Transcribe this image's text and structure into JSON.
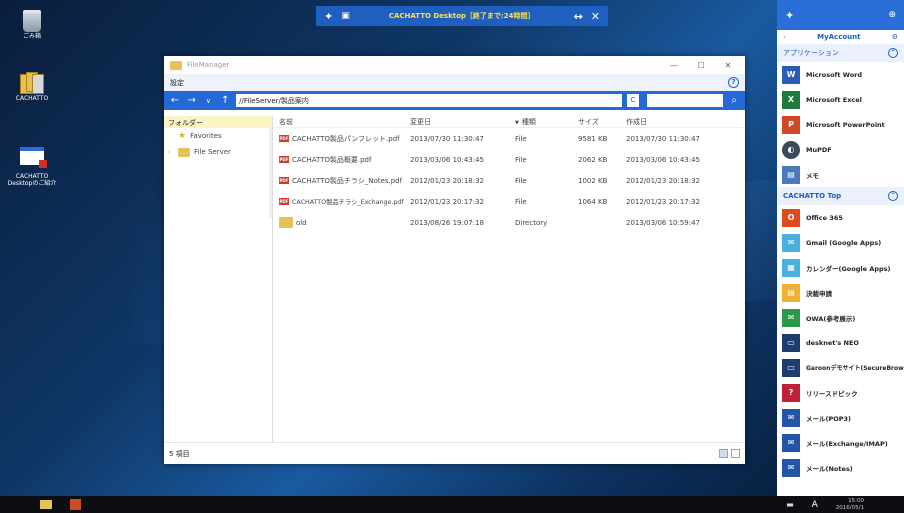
{
  "desktop": {
    "icons": [
      {
        "label": "ごみ箱"
      },
      {
        "label": "CACHATTO"
      },
      {
        "label": "CACHATTO\nDesktopのご紹介"
      }
    ]
  },
  "topbar": {
    "pin_icon": "pin-icon",
    "title": "CACHATTO Desktop［終了まで:24時間］",
    "resize_icon": "resize-icon",
    "close_icon": "close-icon"
  },
  "window": {
    "title": "FileManager",
    "controls": {
      "minimize": "—",
      "maximize": "☐",
      "close": "✕"
    },
    "menu": {
      "settings": "設定",
      "help": "?"
    },
    "address": "//FileServer/製品案内",
    "refresh": "C",
    "search_placeholder": ""
  },
  "tree": {
    "header": "フォルダー",
    "items": [
      {
        "label": "Favorites",
        "icon": "star-icon"
      },
      {
        "label": "File Server",
        "icon": "folder-icon"
      }
    ]
  },
  "list": {
    "columns": {
      "name": "名前",
      "modified": "変更日",
      "type": "種類",
      "size": "サイズ",
      "created": "作成日"
    },
    "rows": [
      {
        "name": "CACHATTO製品パンフレット.pdf",
        "modified": "2013/07/30 11:30:47",
        "type": "File",
        "size": "9581 KB",
        "created": "2013/07/30 11:30:47",
        "icon": "pdf"
      },
      {
        "name": "CACHATTO製品概要.pdf",
        "modified": "2013/03/06 10:43:45",
        "type": "File",
        "size": "2062 KB",
        "created": "2013/03/06 10:43:45",
        "icon": "pdf"
      },
      {
        "name": "CACHATTO製品チラシ_Notes.pdf",
        "modified": "2012/01/23 20:18:32",
        "type": "File",
        "size": "1002 KB",
        "created": "2012/01/23 20:18:32",
        "icon": "pdf"
      },
      {
        "name": "CACHATTO製品チラシ_Exchange.pdf",
        "modified": "2012/01/23 20:17:32",
        "type": "File",
        "size": "1064 KB",
        "created": "2012/01/23 20:17:32",
        "icon": "pdf"
      },
      {
        "name": "old",
        "modified": "2013/08/26 19:07:18",
        "type": "Directory",
        "size": "",
        "created": "2013/03/06 10:59:47",
        "icon": "folder"
      }
    ],
    "status": "5 項目"
  },
  "sidebar": {
    "account": "MyAccount",
    "sections": {
      "apps": {
        "label": "アプリケーション",
        "items": [
          {
            "label": "Microsoft Word",
            "icon": "word-icon",
            "color": "#2b5cb8",
            "glyph": "W"
          },
          {
            "label": "Microsoft Excel",
            "icon": "excel-icon",
            "color": "#1f7a3d",
            "glyph": "X"
          },
          {
            "label": "Microsoft PowerPoint",
            "icon": "powerpoint-icon",
            "color": "#d24726",
            "glyph": "P"
          },
          {
            "label": "MuPDF",
            "icon": "mupdf-icon",
            "color": "#3a4a5a",
            "glyph": "◐"
          },
          {
            "label": "メモ",
            "icon": "memo-icon",
            "color": "#4a7ab8",
            "glyph": "▤"
          }
        ]
      },
      "top": {
        "label": "CACHATTO Top",
        "items": [
          {
            "label": "Office 365",
            "icon": "office365-icon",
            "color": "#e04a1c",
            "glyph": "O"
          },
          {
            "label": "Gmail (Google Apps)",
            "icon": "gmail-icon",
            "color": "#4ab0e0",
            "glyph": "✉"
          },
          {
            "label": "カレンダー(Google Apps)",
            "icon": "calendar-icon",
            "color": "#4ab0e0",
            "glyph": "▦"
          },
          {
            "label": "決裁申請",
            "icon": "approval-icon",
            "color": "#f0b030",
            "glyph": "▤"
          },
          {
            "label": "OWA(参考展示)",
            "icon": "owa-icon",
            "color": "#2a9a4a",
            "glyph": "✉"
          },
          {
            "label": "desknet's NEO",
            "icon": "desknets-icon",
            "color": "#1e3c6c",
            "glyph": "▭"
          },
          {
            "label": "Garoonデモサイト(SecureBrowser)",
            "icon": "garoon-icon",
            "color": "#1e3c6c",
            "glyph": "▭"
          },
          {
            "label": "リリースドピック",
            "icon": "release-icon",
            "color": "#c0203a",
            "glyph": "?"
          },
          {
            "label": "メール(POP3)",
            "icon": "mail-pop3-icon",
            "color": "#2255a8",
            "glyph": "✉"
          },
          {
            "label": "メール(Exchange/IMAP)",
            "icon": "mail-exchange-icon",
            "color": "#2255a8",
            "glyph": "✉"
          },
          {
            "label": "メール(Notes)",
            "icon": "mail-notes-icon",
            "color": "#2255a8",
            "glyph": "✉"
          }
        ]
      }
    }
  },
  "taskbar": {
    "clock_time": "15:00",
    "clock_date": "2016/05/1",
    "ime": "A"
  }
}
